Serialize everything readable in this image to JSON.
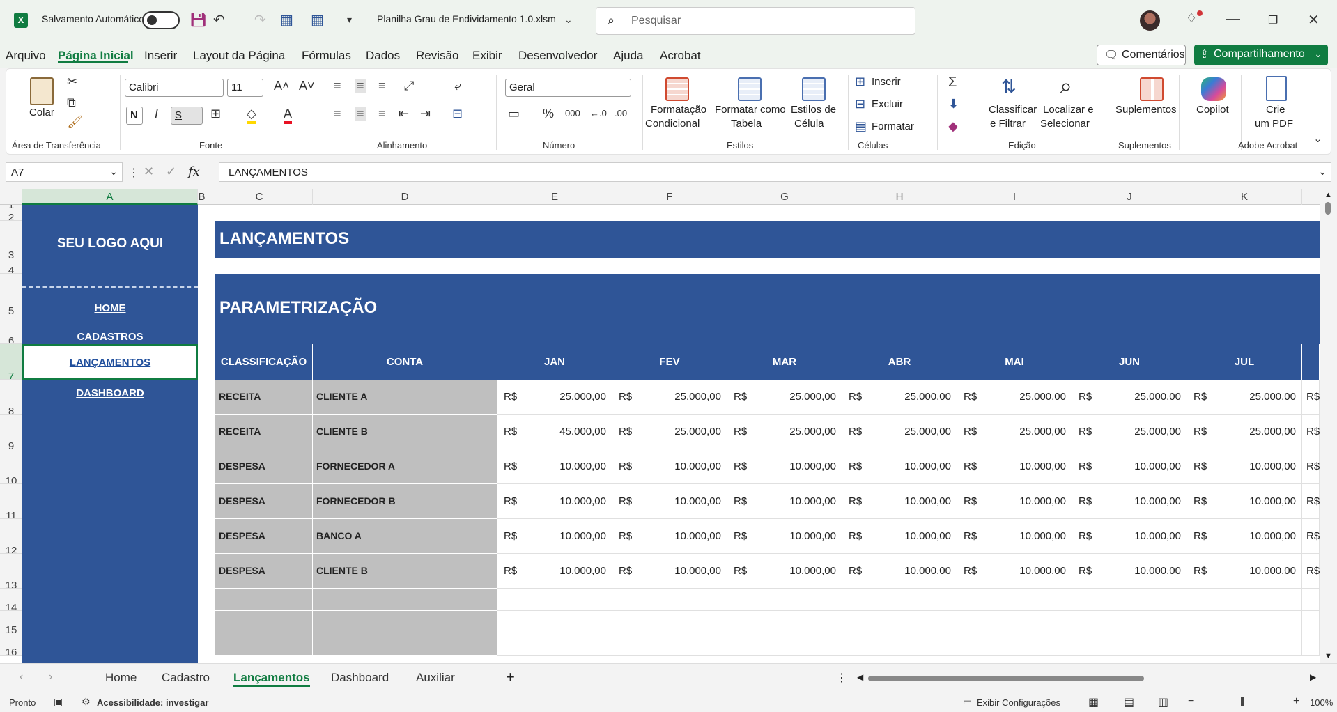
{
  "titlebar": {
    "autosave_label": "Salvamento Automático",
    "filename": "Planilha Grau de Endividamento 1.0.xlsm",
    "search_placeholder": "Pesquisar"
  },
  "menu": {
    "tabs": [
      "Arquivo",
      "Página Inicial",
      "Inserir",
      "Layout da Página",
      "Fórmulas",
      "Dados",
      "Revisão",
      "Exibir",
      "Desenvolvedor",
      "Ajuda",
      "Acrobat"
    ],
    "active_tab": "Página Inicial",
    "comments_label": "Comentários",
    "share_label": "Compartilhamento"
  },
  "ribbon": {
    "clipboard": {
      "paste": "Colar",
      "group": "Área de Transferência"
    },
    "font": {
      "name": "Calibri",
      "size": "11",
      "bold": "N",
      "italic": "I",
      "underline": "S",
      "group": "Fonte"
    },
    "alignment": {
      "group": "Alinhamento"
    },
    "number": {
      "format": "Geral",
      "group": "Número"
    },
    "styles": {
      "cond1": "Formatação",
      "cond2": "Condicional",
      "table1": "Formatar como",
      "table2": "Tabela",
      "cell1": "Estilos de",
      "cell2": "Célula",
      "group": "Estilos"
    },
    "cells": {
      "insert": "Inserir",
      "delete": "Excluir",
      "format": "Formatar",
      "group": "Células"
    },
    "editing": {
      "sort1": "Classificar",
      "sort2": "e Filtrar",
      "find1": "Localizar e",
      "find2": "Selecionar",
      "group": "Edição"
    },
    "addins": {
      "label": "Suplementos",
      "group": "Suplementos"
    },
    "copilot": {
      "label": "Copilot"
    },
    "acrobat": {
      "label1": "Crie",
      "label2": "um PDF",
      "group": "Adobe Acrobat"
    }
  },
  "formula": {
    "namebox": "A7",
    "content": "LANÇAMENTOS"
  },
  "columns": [
    "A",
    "B",
    "C",
    "D",
    "E",
    "F",
    "G",
    "H",
    "I",
    "J",
    "K"
  ],
  "selected_column": "A",
  "rows": [
    "1",
    "2",
    "3",
    "4",
    "5",
    "6",
    "7",
    "8",
    "9",
    "10",
    "11",
    "12",
    "13",
    "14",
    "15",
    "16"
  ],
  "selected_row": "7",
  "sidebar": {
    "logo": "SEU LOGO AQUI",
    "nav": [
      "HOME",
      "CADASTROS",
      "LANÇAMENTOS",
      "DASHBOARD"
    ],
    "active": "LANÇAMENTOS"
  },
  "sheet": {
    "title": "LANÇAMENTOS",
    "subtitle": "PARAMETRIZAÇÃO",
    "headers": [
      "CLASSIFICAÇÃO",
      "CONTA",
      "JAN",
      "FEV",
      "MAR",
      "ABR",
      "MAI",
      "JUN",
      "JUL"
    ],
    "currency": "R$",
    "records": [
      {
        "class": "RECEITA",
        "account": "CLIENTE A",
        "values": [
          "25.000,00",
          "25.000,00",
          "25.000,00",
          "25.000,00",
          "25.000,00",
          "25.000,00",
          "25.000,00"
        ]
      },
      {
        "class": "RECEITA",
        "account": "CLIENTE B",
        "values": [
          "45.000,00",
          "25.000,00",
          "25.000,00",
          "25.000,00",
          "25.000,00",
          "25.000,00",
          "25.000,00"
        ]
      },
      {
        "class": "DESPESA",
        "account": "FORNECEDOR A",
        "values": [
          "10.000,00",
          "10.000,00",
          "10.000,00",
          "10.000,00",
          "10.000,00",
          "10.000,00",
          "10.000,00"
        ]
      },
      {
        "class": "DESPESA",
        "account": "FORNECEDOR B",
        "values": [
          "10.000,00",
          "10.000,00",
          "10.000,00",
          "10.000,00",
          "10.000,00",
          "10.000,00",
          "10.000,00"
        ]
      },
      {
        "class": "DESPESA",
        "account": "BANCO A",
        "values": [
          "10.000,00",
          "10.000,00",
          "10.000,00",
          "10.000,00",
          "10.000,00",
          "10.000,00",
          "10.000,00"
        ]
      },
      {
        "class": "DESPESA",
        "account": "CLIENTE B",
        "values": [
          "10.000,00",
          "10.000,00",
          "10.000,00",
          "10.000,00",
          "10.000,00",
          "10.000,00",
          "10.000,00"
        ]
      }
    ]
  },
  "sheet_tabs": [
    "Home",
    "Cadastro",
    "Lançamentos",
    "Dashboard",
    "Auxiliar"
  ],
  "active_sheet": "Lançamentos",
  "status": {
    "ready": "Pronto",
    "accessibility": "Acessibilidade: investigar",
    "display_settings": "Exibir Configurações",
    "zoom": "100%"
  },
  "colors": {
    "accent": "#107c41",
    "header_blue": "#2f5597",
    "gray_cell": "#bfbfbf"
  }
}
